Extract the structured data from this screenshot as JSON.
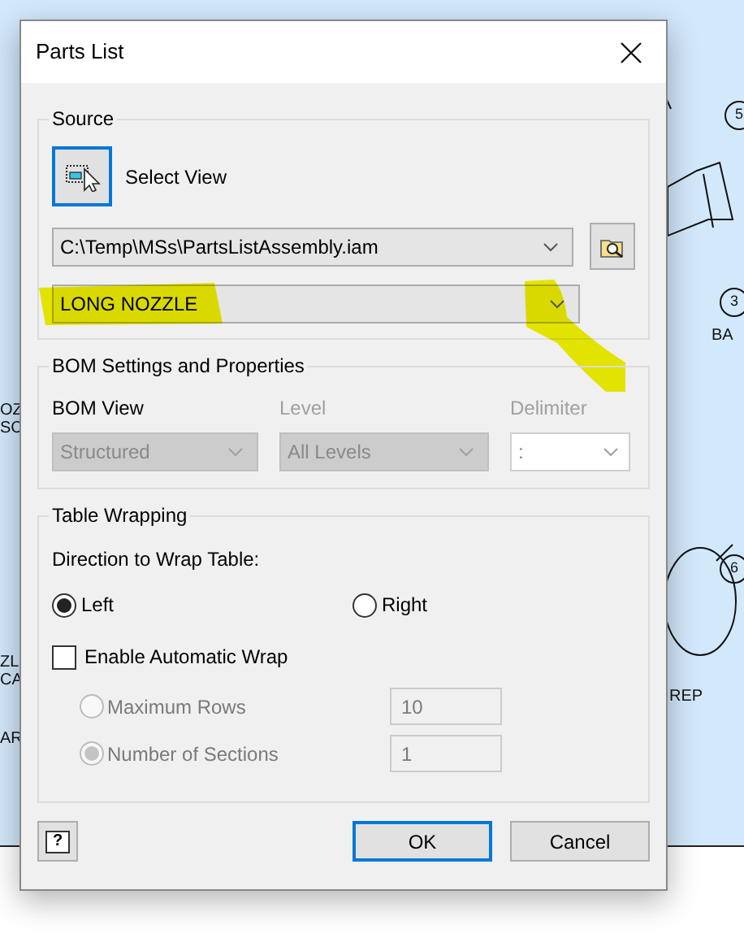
{
  "background": {
    "balloons": [
      "5",
      "3",
      "6"
    ],
    "labels": [
      "BA",
      "REP",
      "OZ",
      "SC",
      "ZL",
      "CA",
      "AR"
    ]
  },
  "window": {
    "title": "Parts List"
  },
  "source": {
    "title": "Source",
    "select_view": "Select View",
    "file": "C:\\Temp\\MSs\\PartsListAssembly.iam",
    "view": "LONG NOZZLE"
  },
  "bom": {
    "title": "BOM Settings and Properties",
    "fields": [
      {
        "label": "BOM View",
        "value": "Structured",
        "kind": "dropdown",
        "label_disabled": false,
        "disabled": true
      },
      {
        "label": "Level",
        "value": "All Levels",
        "kind": "dropdown",
        "label_disabled": true,
        "disabled": true
      },
      {
        "label": "Delimiter",
        "value": ":",
        "kind": "editable",
        "label_disabled": true,
        "disabled": true
      }
    ]
  },
  "wrapping": {
    "title": "Table Wrapping",
    "direction_label": "Direction to Wrap Table:",
    "directions": [
      {
        "label": "Left",
        "selected": true
      },
      {
        "label": "Right",
        "selected": false
      }
    ],
    "auto_wrap": {
      "label": "Enable Automatic Wrap",
      "checked": false
    },
    "options": [
      {
        "label": "Maximum Rows",
        "value": "10",
        "selected": false,
        "disabled": true
      },
      {
        "label": "Number of Sections",
        "value": "1",
        "selected": true,
        "disabled": true
      }
    ]
  },
  "help": "?",
  "buttons": [
    {
      "label": "OK",
      "default": true
    },
    {
      "label": "Cancel",
      "default": false
    }
  ]
}
